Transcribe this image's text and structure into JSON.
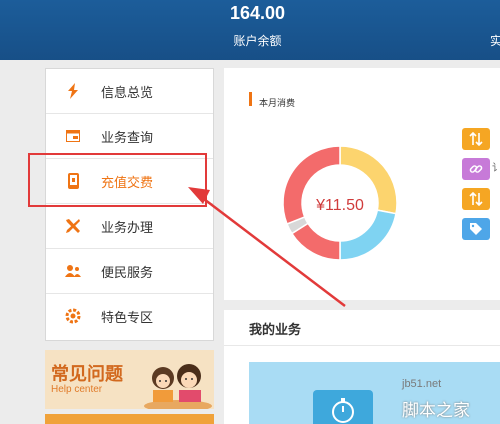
{
  "header": {
    "balance": "164.00",
    "balance_label": "账户余额",
    "right_label_partial": "实"
  },
  "sidebar": {
    "items": [
      {
        "label": "信息总览",
        "icon": "overview-icon"
      },
      {
        "label": "业务查询",
        "icon": "query-icon"
      },
      {
        "label": "充值交费",
        "icon": "recharge-phone-icon",
        "active": true
      },
      {
        "label": "业务办理",
        "icon": "tools-icon"
      },
      {
        "label": "便民服务",
        "icon": "people-icon"
      },
      {
        "label": "特色专区",
        "icon": "gear-icon"
      }
    ]
  },
  "help": {
    "title": "常见问题",
    "subtitle": "Help center"
  },
  "monthly": {
    "title": "本月消费",
    "amount": "¥11.50",
    "chart_data": {
      "type": "pie",
      "slices": [
        {
          "color": "#fcd46e",
          "value": 0.28
        },
        {
          "color": "#7fd3f2",
          "value": 0.22
        },
        {
          "color": "#f36b6b",
          "value": 0.16
        },
        {
          "color": "#d8d8d8",
          "value": 0.03
        },
        {
          "color": "#f36b6b",
          "value": 0.31
        }
      ]
    }
  },
  "right_icons": [
    {
      "icon": "exchange-icon",
      "color": "#f5a623",
      "text": ""
    },
    {
      "icon": "link-icon",
      "color": "#c77ad8",
      "text": "讠"
    },
    {
      "icon": "exchange-icon",
      "color": "#f5a623",
      "text": ""
    },
    {
      "icon": "tag-icon",
      "color": "#4ea6e8",
      "text": ""
    }
  ],
  "my_business": {
    "title": "我的业务"
  },
  "watermark": {
    "site": "jb51.net",
    "text": "脚本之家"
  }
}
